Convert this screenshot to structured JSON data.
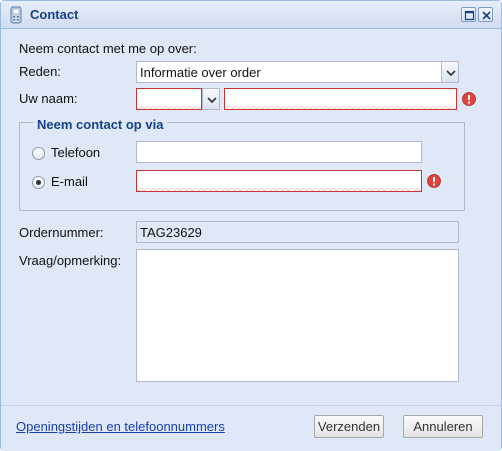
{
  "window": {
    "title": "Contact"
  },
  "form": {
    "intro": "Neem contact met me op over:",
    "reason": {
      "label": "Reden:",
      "value": "Informatie over order"
    },
    "name": {
      "label": "Uw naam:",
      "salutation": "",
      "value": ""
    },
    "contact_group": {
      "legend": "Neem contact op via",
      "phone": {
        "label": "Telefoon",
        "value": "",
        "checked": false
      },
      "email": {
        "label": "E-mail",
        "value": "",
        "checked": true
      }
    },
    "order": {
      "label": "Ordernummer:",
      "value": "TAG23629"
    },
    "question": {
      "label": "Vraag/opmerking:",
      "value": ""
    }
  },
  "footer": {
    "link": "Openingstijden en telefoonnummers",
    "send": "Verzenden",
    "cancel": "Annuleren"
  },
  "colors": {
    "title": "#15428b",
    "error": "#cc3333",
    "panel": "#dfe8f6"
  },
  "icons": {
    "window": "phone-icon",
    "maximize": "maximize-icon",
    "close": "close-icon",
    "error": "error-icon",
    "dropdown": "chevron-down-icon"
  }
}
